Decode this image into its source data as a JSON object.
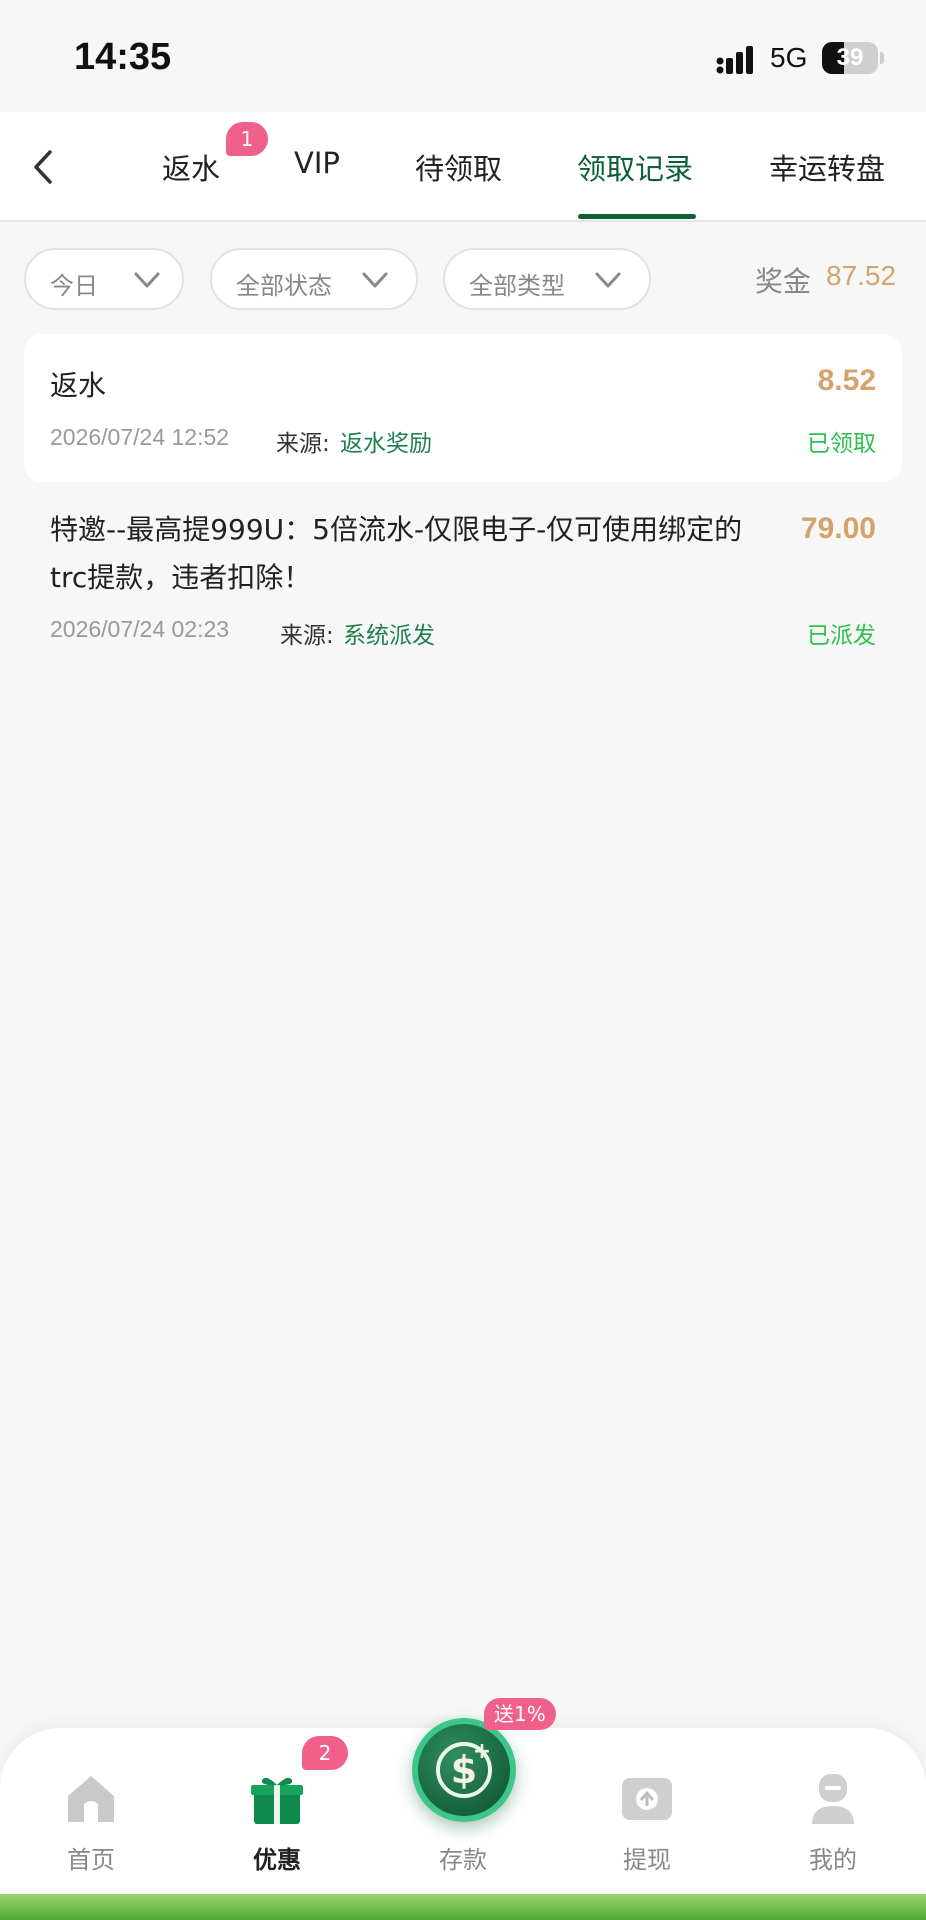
{
  "status_bar": {
    "time": "14:35",
    "network": "5G",
    "battery": "39",
    "battery_level": 0.39
  },
  "tabs": [
    {
      "label": "返水",
      "badge": "1"
    },
    {
      "label": "VIP"
    },
    {
      "label": "待领取"
    },
    {
      "label": "领取记录",
      "active": true
    },
    {
      "label": "幸运转盘"
    }
  ],
  "filters": {
    "date": "今日",
    "status": "全部状态",
    "type": "全部类型"
  },
  "bonus": {
    "label": "奖金",
    "value": "87.52"
  },
  "records": [
    {
      "title": "返水",
      "amount": "8.52",
      "date": "2026/07/24 12:52",
      "source_label": "来源:",
      "source": "返水奖励",
      "status": "已领取"
    },
    {
      "title": "特邀--最高提999U：5倍流水-仅限电子-仅可使用绑定的trc提款，违者扣除！",
      "amount": "79.00",
      "date": "2026/07/24 02:23",
      "source_label": "来源:",
      "source": "系统派发",
      "status": "已派发"
    }
  ],
  "bottom_nav": {
    "items": [
      {
        "label": "首页",
        "icon": "home-icon"
      },
      {
        "label": "优惠",
        "icon": "gift-icon",
        "badge": "2",
        "active": true
      },
      {
        "label": "存款",
        "icon": "deposit-icon",
        "promo": "送1%"
      },
      {
        "label": "提现",
        "icon": "withdraw-icon"
      },
      {
        "label": "我的",
        "icon": "profile-icon"
      }
    ]
  },
  "colors": {
    "accent": "#0d5f3a",
    "amount": "#d2a36b",
    "status": "#2ec04f",
    "badge": "#f0608a"
  }
}
